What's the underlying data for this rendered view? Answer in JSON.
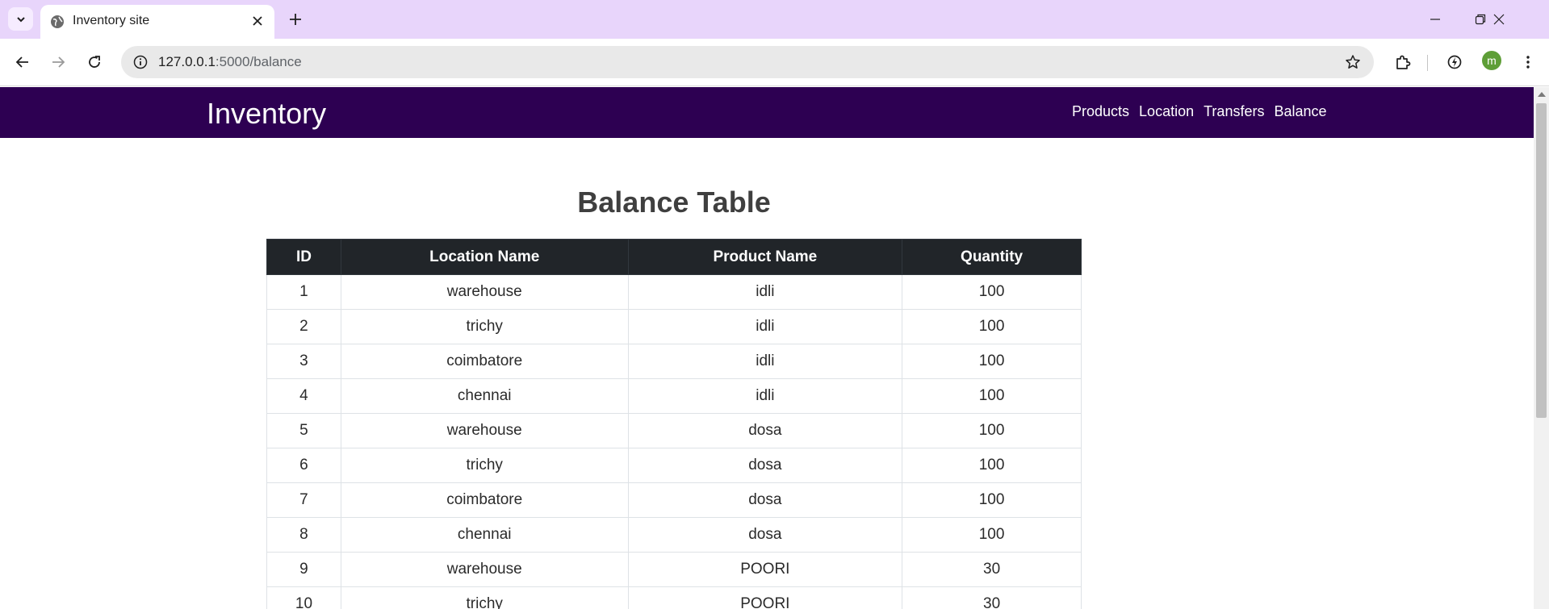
{
  "browser": {
    "tab_title": "Inventory site",
    "url_host": "127.0.0.1",
    "url_path": ":5000/balance",
    "profile_initial": "m"
  },
  "site": {
    "brand": "Inventory",
    "nav": [
      "Products",
      "Location",
      "Transfers",
      "Balance"
    ],
    "nav_color": "#2d0052"
  },
  "page": {
    "heading": "Balance Table"
  },
  "table": {
    "columns": [
      "ID",
      "Location Name",
      "Product Name",
      "Quantity"
    ],
    "rows": [
      [
        "1",
        "warehouse",
        "idli",
        "100"
      ],
      [
        "2",
        "trichy",
        "idli",
        "100"
      ],
      [
        "3",
        "coimbatore",
        "idli",
        "100"
      ],
      [
        "4",
        "chennai",
        "idli",
        "100"
      ],
      [
        "5",
        "warehouse",
        "dosa",
        "100"
      ],
      [
        "6",
        "trichy",
        "dosa",
        "100"
      ],
      [
        "7",
        "coimbatore",
        "dosa",
        "100"
      ],
      [
        "8",
        "chennai",
        "dosa",
        "100"
      ],
      [
        "9",
        "warehouse",
        "POORI",
        "30"
      ],
      [
        "10",
        "trichy",
        "POORI",
        "30"
      ]
    ]
  }
}
